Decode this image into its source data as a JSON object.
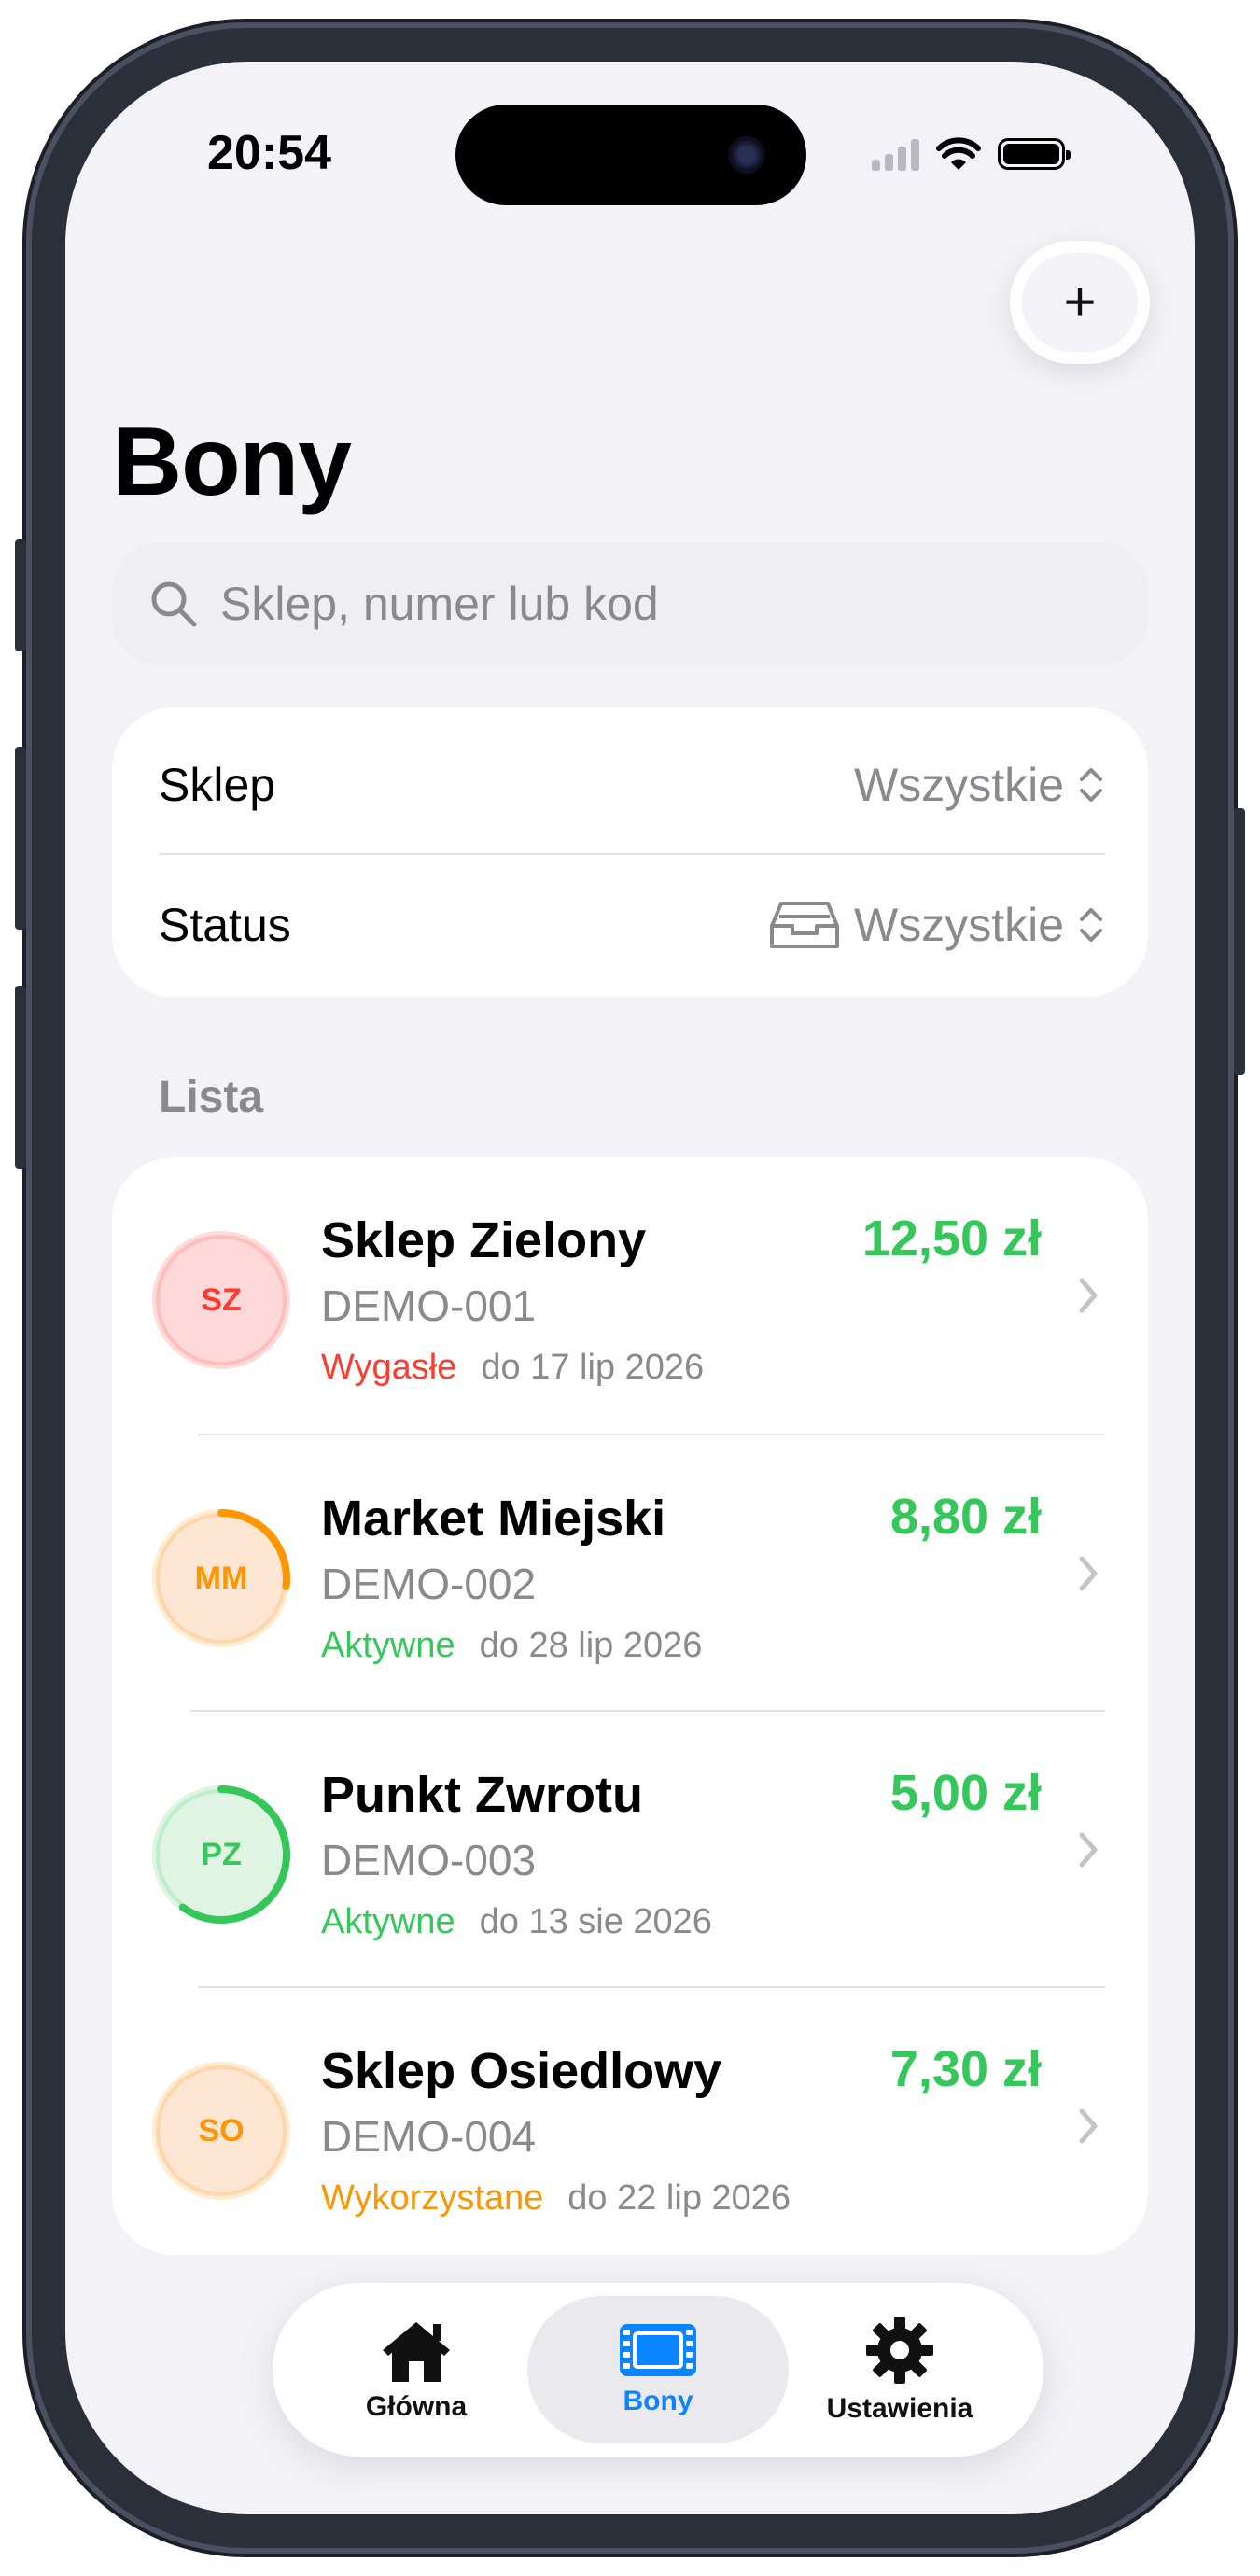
{
  "status_bar": {
    "time": "20:54"
  },
  "header": {
    "title": "Bony",
    "add_button_label": "+"
  },
  "search": {
    "placeholder": "Sklep, numer lub kod"
  },
  "filters": {
    "shop": {
      "label": "Sklep",
      "value": "Wszystkie"
    },
    "status": {
      "label": "Status",
      "value": "Wszystkie"
    }
  },
  "list": {
    "section_title": "Lista",
    "items": [
      {
        "initials": "SZ",
        "name": "Sklep Zielony",
        "code": "DEMO-001",
        "status": "Wygasłe",
        "date": "do 17 lip 2026",
        "amount": "12,50 zł",
        "accent": "#ff3b30",
        "bg": "#ffd9d9",
        "progress": 0
      },
      {
        "initials": "MM",
        "name": "Market Miejski",
        "code": "DEMO-002",
        "status": "Aktywne",
        "date": "do 28 lip 2026",
        "amount": "8,80 zł",
        "accent": "#ff9500",
        "bg": "#fde6d2",
        "progress": 0.27
      },
      {
        "initials": "PZ",
        "name": "Punkt Zwrotu",
        "code": "DEMO-003",
        "status": "Aktywne",
        "date": "do 13 sie 2026",
        "amount": "5,00 zł",
        "accent": "#34c759",
        "bg": "#dff4e3",
        "progress": 0.6
      },
      {
        "initials": "SO",
        "name": "Sklep Osiedlowy",
        "code": "DEMO-004",
        "status": "Wykorzystane",
        "date": "do 22 lip 2026",
        "amount": "7,30 zł",
        "accent": "#ff9500",
        "bg": "#fde6d2",
        "progress": 0
      }
    ]
  },
  "status_colors": {
    "Wygasłe": "#ff3b30",
    "Aktywne": "#34c759",
    "Wykorzystane": "#ff9500"
  },
  "tabbar": {
    "tabs": [
      {
        "label": "Główna",
        "icon": "house-icon"
      },
      {
        "label": "Bony",
        "icon": "ticket-icon",
        "active": true
      },
      {
        "label": "Ustawienia",
        "icon": "gear-icon"
      }
    ]
  }
}
